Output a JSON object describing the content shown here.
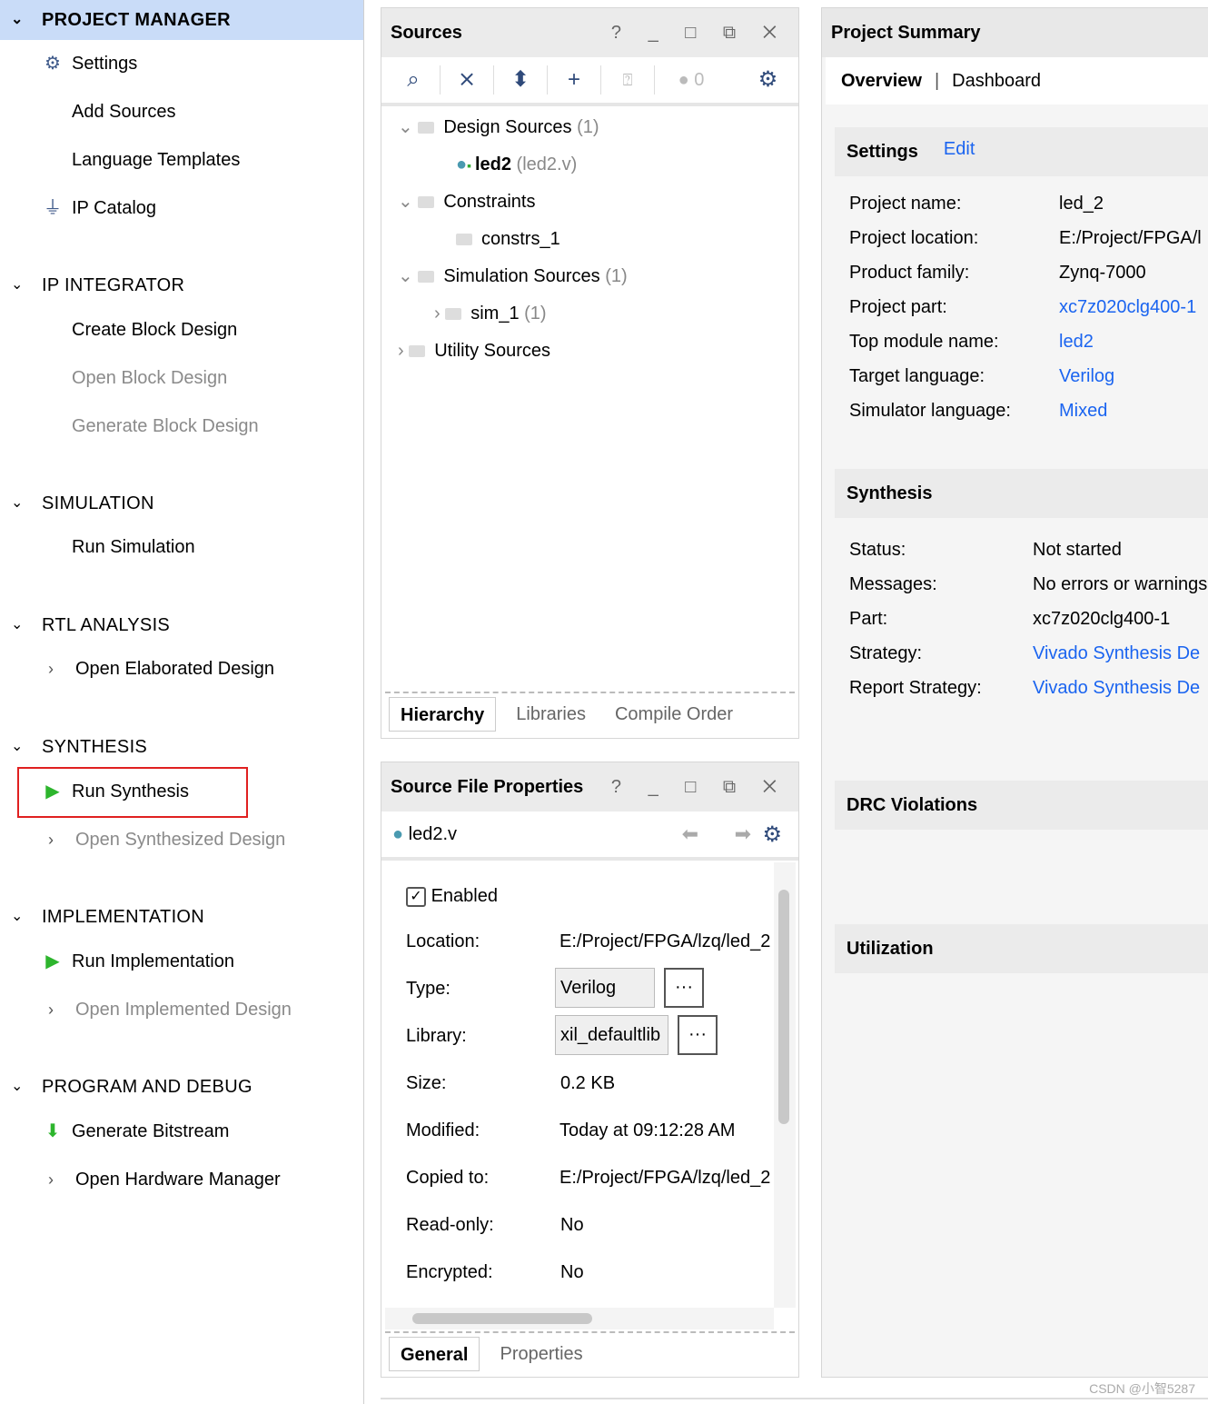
{
  "flow_navigator": {
    "sections": [
      {
        "label": "PROJECT MANAGER",
        "items": [
          {
            "label": "Settings",
            "icon": "gear-icon"
          },
          {
            "label": "Add Sources"
          },
          {
            "label": "Language Templates"
          },
          {
            "label": "IP Catalog",
            "icon": "ip-catalog-icon"
          }
        ]
      },
      {
        "label": "IP INTEGRATOR",
        "items": [
          {
            "label": "Create Block Design"
          },
          {
            "label": "Open Block Design"
          },
          {
            "label": "Generate Block Design"
          }
        ]
      },
      {
        "label": "SIMULATION",
        "items": [
          {
            "label": "Run Simulation"
          }
        ]
      },
      {
        "label": "RTL ANALYSIS",
        "items": [
          {
            "label": "Open Elaborated Design"
          }
        ]
      },
      {
        "label": "SYNTHESIS",
        "items": [
          {
            "label": "Run Synthesis",
            "icon": "play-icon"
          },
          {
            "label": "Open Synthesized Design"
          }
        ]
      },
      {
        "label": "IMPLEMENTATION",
        "items": [
          {
            "label": "Run Implementation",
            "icon": "play-icon"
          },
          {
            "label": "Open Implemented Design"
          }
        ]
      },
      {
        "label": "PROGRAM AND DEBUG",
        "items": [
          {
            "label": "Generate Bitstream",
            "icon": "bitstream-icon"
          },
          {
            "label": "Open Hardware Manager"
          }
        ]
      }
    ]
  },
  "sources": {
    "title": "Sources",
    "window_controls": "? _ □ ⧉ ✕",
    "messages_count": "0",
    "tree": [
      {
        "label": "Design Sources",
        "count": "(1)"
      },
      {
        "label": "led2",
        "file": "(led2.v)"
      },
      {
        "label": "Constraints"
      },
      {
        "label": "constrs_1"
      },
      {
        "label": "Simulation Sources",
        "count": "(1)"
      },
      {
        "label": "sim_1",
        "count": "(1)"
      },
      {
        "label": "Utility Sources"
      }
    ],
    "tabs": [
      "Hierarchy",
      "Libraries",
      "Compile Order"
    ]
  },
  "file_props": {
    "title": "Source File Properties",
    "file": "led2.v",
    "enabled_label": "Enabled",
    "rows": [
      {
        "label": "Location:",
        "value": "E:/Project/FPGA/lzq/led_2"
      },
      {
        "label": "Type:",
        "value": "Verilog"
      },
      {
        "label": "Library:",
        "value": "xil_defaultlib"
      },
      {
        "label": "Size:",
        "value": "0.2 KB"
      },
      {
        "label": "Modified:",
        "value": "Today at 09:12:28 AM"
      },
      {
        "label": "Copied to:",
        "value": "E:/Project/FPGA/lzq/led_2"
      },
      {
        "label": "Read-only:",
        "value": "No"
      },
      {
        "label": "Encrypted:",
        "value": "No"
      }
    ],
    "ellipsis": "···",
    "tabs": [
      "General",
      "Properties"
    ]
  },
  "summary": {
    "title": "Project Summary",
    "tabs": [
      "Overview",
      "Dashboard"
    ],
    "settings": "Settings",
    "edit": "Edit",
    "settings_rows": [
      {
        "label": "Project name:",
        "value": "led_2"
      },
      {
        "label": "Project location:",
        "value": "E:/Project/FPGA/l"
      },
      {
        "label": "Product family:",
        "value": "Zynq-7000"
      },
      {
        "label": "Project part:",
        "value": "xc7z020clg400-1"
      },
      {
        "label": "Top module name:",
        "value": "led2"
      },
      {
        "label": "Target language:",
        "value": "Verilog"
      },
      {
        "label": "Simulator language:",
        "value": "Mixed"
      }
    ],
    "synthesis": "Synthesis",
    "synthesis_rows": [
      {
        "label": "Status:",
        "value": "Not started"
      },
      {
        "label": "Messages:",
        "value": "No errors or warnings"
      },
      {
        "label": "Part:",
        "value": "xc7z020clg400-1"
      },
      {
        "label": "Strategy:",
        "value": "Vivado Synthesis De"
      },
      {
        "label": "Report Strategy:",
        "value": "Vivado Synthesis De"
      }
    ],
    "drc": "DRC Violations",
    "utilization": "Utilization"
  },
  "watermark": "CSDN @小智5287",
  "colors": {
    "accent": "#1a64f0",
    "highlight": "#e02020",
    "play": "#2db52d",
    "selected": "#c9dcf8"
  }
}
